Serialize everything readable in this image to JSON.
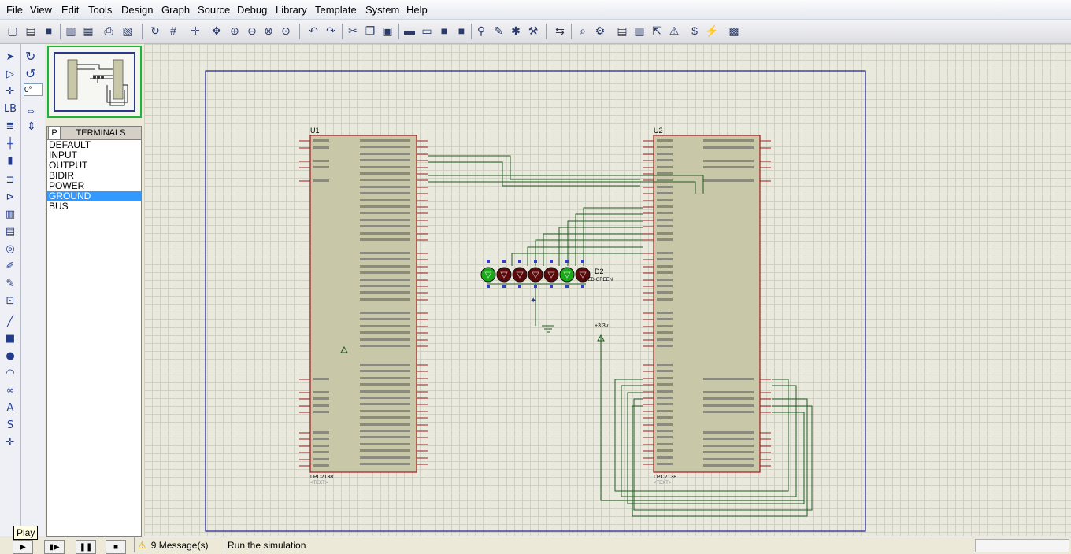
{
  "menu": [
    "File",
    "View",
    "Edit",
    "Tools",
    "Design",
    "Graph",
    "Source",
    "Debug",
    "Library",
    "Template",
    "System",
    "Help"
  ],
  "rotation": {
    "angle_value": "0°"
  },
  "device_panel": {
    "p_button": "P",
    "title": "TERMINALS",
    "items": [
      "DEFAULT",
      "INPUT",
      "OUTPUT",
      "BIDIR",
      "POWER",
      "GROUND",
      "BUS"
    ],
    "selected": "GROUND"
  },
  "tooltip": {
    "play": "Play"
  },
  "status": {
    "messages": "9 Message(s)",
    "hint": "Run the simulation"
  },
  "schematic": {
    "u1": {
      "ref": "U1",
      "part": "LPC2138",
      "text": "<TEXT>"
    },
    "u2": {
      "ref": "U2",
      "part": "LPC2138",
      "text": "<TEXT>"
    },
    "d2": {
      "ref": "D2",
      "value": "LED-GREEN"
    },
    "power_label": "+3.3v"
  },
  "colors": {
    "wire": "#1e5a1e",
    "chip_fill": "#c8c8a8",
    "chip_border": "#a01a1a",
    "frame": "#1a1a9a",
    "led_dark": "#5a0a0a",
    "led_green": "#1aa81a"
  }
}
